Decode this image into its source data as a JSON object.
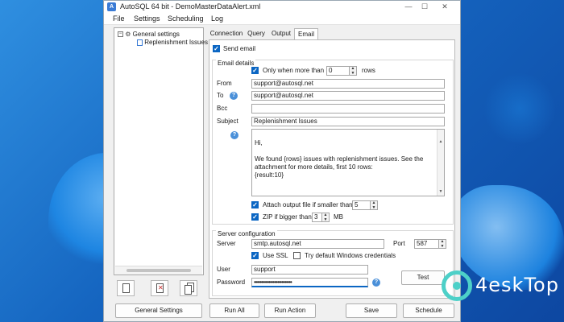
{
  "window": {
    "title": "AutoSQL 64 bit - DemoMasterDataAlert.xml",
    "controls": {
      "minimize": "—",
      "maximize": "☐",
      "close": "✕"
    }
  },
  "menu": [
    "File",
    "Settings",
    "Scheduling",
    "Log"
  ],
  "tree": {
    "root": "General settings",
    "child": "Replenishment Issues"
  },
  "tabs": [
    "Connection",
    "Query",
    "Output",
    "Email"
  ],
  "email": {
    "send_email_label": "Send email",
    "details_title": "Email details",
    "only_when_label": "Only when more than",
    "only_when_value": "0",
    "rows_label": "rows",
    "from_label": "From",
    "from_value": "support@autosql.net",
    "to_label": "To",
    "to_value": "support@autosql.net",
    "bcc_label": "Bcc",
    "bcc_value": "",
    "subject_label": "Subject",
    "subject_value": "Replenishment Issues",
    "body": "Hi,\n\nWe found {rows} issues with replenishment issues. See the attachment for more details, first 10 rows:\n{result:10}\n\n\nKind regards,\nMaster Data Team",
    "attach_label": "Attach output file if smaller than",
    "attach_value": "5",
    "zip_label": "ZIP if bigger than",
    "zip_value": "3",
    "zip_unit": "MB"
  },
  "server": {
    "title": "Server configuration",
    "server_label": "Server",
    "server_value": "smtp.autosql.net",
    "port_label": "Port",
    "port_value": "587",
    "ssl_label": "Use SSL",
    "win_cred_label": "Try default Windows credentials",
    "user_label": "User",
    "user_value": "support",
    "password_label": "Password",
    "password_value": "••••••••••••••••••••••••••",
    "test_button": "Test"
  },
  "buttons": {
    "general_settings": "General Settings",
    "run_all": "Run All",
    "run_action": "Run Action",
    "save": "Save",
    "schedule": "Schedule"
  },
  "watermark": "4eskTop",
  "colors": {
    "accent": "#0b66c3",
    "help": "#4a90d9",
    "watermark": "#4dd0c8"
  }
}
